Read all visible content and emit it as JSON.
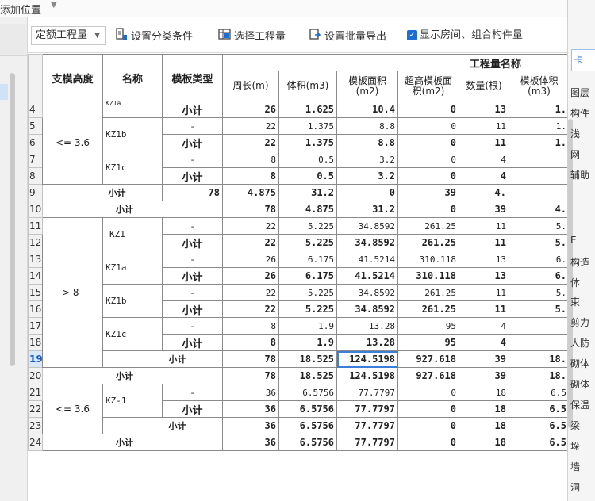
{
  "top": {
    "label": "添加位置"
  },
  "toolbar": {
    "select_value": "定额工程量",
    "set_category": "设置分类条件",
    "choose_quantity": "选择工程量",
    "batch_export": "设置批量导出",
    "show_rooms": "显示房间、组合构件量"
  },
  "right_panel": {
    "tab": "卡",
    "items": [
      "图层",
      "构件",
      "浅",
      "网",
      "辅助",
      "E",
      "构造",
      "体",
      "束",
      "剪力",
      "人防",
      "砌体",
      "砌体",
      "保温",
      "梁",
      "垛",
      "墙",
      "洞"
    ]
  },
  "header": {
    "col_height": "支模高度",
    "col_name": "名称",
    "col_type": "模板类型",
    "group_title": "工程量名称",
    "perimeter": "周长(m)",
    "volume": "体积(m3)",
    "formwork_area": "模板面积(m2)",
    "super_area": "超高模板面积(m2)",
    "count": "数量(根)",
    "formwork_vol": "模板体积(m3)"
  },
  "groups": {
    "h1": "<= 3.6",
    "h2": "> 8",
    "h3": "<= 3.6"
  },
  "names": {
    "kz1a_cut": "KZ1a",
    "kz1b_1": "KZ1b",
    "kz1c_1": "KZ1c",
    "kz1": "KZ1",
    "kz1a": "KZ1a",
    "kz1b_2": "KZ1b",
    "kz1c_2": "KZ1c",
    "kz_1": "KZ-1"
  },
  "rows": [
    {
      "n": "4",
      "type": "小计",
      "p": "26",
      "v": "1.625",
      "a": "10.4",
      "s": "0",
      "c": "13",
      "m": "1."
    },
    {
      "n": "5",
      "type": "-",
      "p": "22",
      "v": "1.375",
      "a": "8.8",
      "s": "0",
      "c": "11",
      "m": "1."
    },
    {
      "n": "6",
      "type": "小计",
      "p": "22",
      "v": "1.375",
      "a": "8.8",
      "s": "0",
      "c": "11",
      "m": "1."
    },
    {
      "n": "7",
      "type": "-",
      "p": "8",
      "v": "0.5",
      "a": "3.2",
      "s": "0",
      "c": "4",
      "m": ""
    },
    {
      "n": "8",
      "type": "小计",
      "p": "8",
      "v": "0.5",
      "a": "3.2",
      "s": "0",
      "c": "4",
      "m": ""
    },
    {
      "n": "9",
      "type": "小计",
      "p": "78",
      "v": "4.875",
      "a": "31.2",
      "s": "0",
      "c": "39",
      "m": "4."
    },
    {
      "n": "10",
      "type": "小计",
      "p": "78",
      "v": "4.875",
      "a": "31.2",
      "s": "0",
      "c": "39",
      "m": "4."
    },
    {
      "n": "11",
      "type": "-",
      "p": "22",
      "v": "5.225",
      "a": "34.8592",
      "s": "261.25",
      "c": "11",
      "m": "5."
    },
    {
      "n": "12",
      "type": "小计",
      "p": "22",
      "v": "5.225",
      "a": "34.8592",
      "s": "261.25",
      "c": "11",
      "m": "5."
    },
    {
      "n": "13",
      "type": "-",
      "p": "26",
      "v": "6.175",
      "a": "41.5214",
      "s": "310.118",
      "c": "13",
      "m": "6."
    },
    {
      "n": "14",
      "type": "小计",
      "p": "26",
      "v": "6.175",
      "a": "41.5214",
      "s": "310.118",
      "c": "13",
      "m": "6."
    },
    {
      "n": "15",
      "type": "-",
      "p": "22",
      "v": "5.225",
      "a": "34.8592",
      "s": "261.25",
      "c": "11",
      "m": "5."
    },
    {
      "n": "16",
      "type": "小计",
      "p": "22",
      "v": "5.225",
      "a": "34.8592",
      "s": "261.25",
      "c": "11",
      "m": "5."
    },
    {
      "n": "17",
      "type": "-",
      "p": "8",
      "v": "1.9",
      "a": "13.28",
      "s": "95",
      "c": "4",
      "m": ""
    },
    {
      "n": "18",
      "type": "小计",
      "p": "8",
      "v": "1.9",
      "a": "13.28",
      "s": "95",
      "c": "4",
      "m": ""
    },
    {
      "n": "19",
      "type": "小计",
      "p": "78",
      "v": "18.525",
      "a": "124.5198",
      "s": "927.618",
      "c": "39",
      "m": "18."
    },
    {
      "n": "20",
      "type": "小计",
      "p": "78",
      "v": "18.525",
      "a": "124.5198",
      "s": "927.618",
      "c": "39",
      "m": "18."
    },
    {
      "n": "21",
      "type": "-",
      "p": "36",
      "v": "6.5756",
      "a": "77.7797",
      "s": "0",
      "c": "18",
      "m": "6.5"
    },
    {
      "n": "22",
      "type": "小计",
      "p": "36",
      "v": "6.5756",
      "a": "77.7797",
      "s": "0",
      "c": "18",
      "m": "6.5"
    },
    {
      "n": "23",
      "type": "小计",
      "p": "36",
      "v": "6.5756",
      "a": "77.7797",
      "s": "0",
      "c": "18",
      "m": "6.5"
    },
    {
      "n": "24",
      "type": "小计",
      "p": "36",
      "v": "6.5756",
      "a": "77.7797",
      "s": "0",
      "c": "18",
      "m": "6.5"
    }
  ]
}
